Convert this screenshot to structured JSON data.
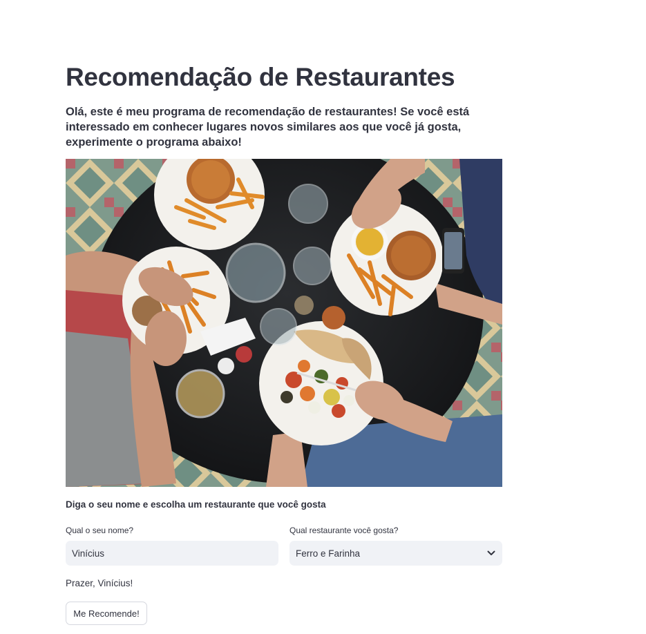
{
  "page": {
    "title": "Recomendação de Restaurantes",
    "intro": "Olá, este é meu programa de recomendação de restaurantes! Se você está interessado em conhecer lugares novos similares aos que você já gosta, experimente o programa abaixo!"
  },
  "hero_image": {
    "subject": "overhead photo of people eating burgers, fries and salad at a round dark table on a tiled floor"
  },
  "form": {
    "heading": "Diga o seu nome e escolha um restaurante que você gosta",
    "name_label": "Qual o seu nome?",
    "name_value": "Vinícius",
    "restaurant_label": "Qual restaurante você gosta?",
    "restaurant_value": "Ferro e Farinha",
    "chevron_icon": "chevron-down-icon"
  },
  "greeting": "Prazer, Vinícius!",
  "button": {
    "label": "Me Recomende!"
  },
  "colors": {
    "text": "#31333f",
    "input_bg": "#f0f2f6",
    "button_border": "#d5d7de"
  }
}
